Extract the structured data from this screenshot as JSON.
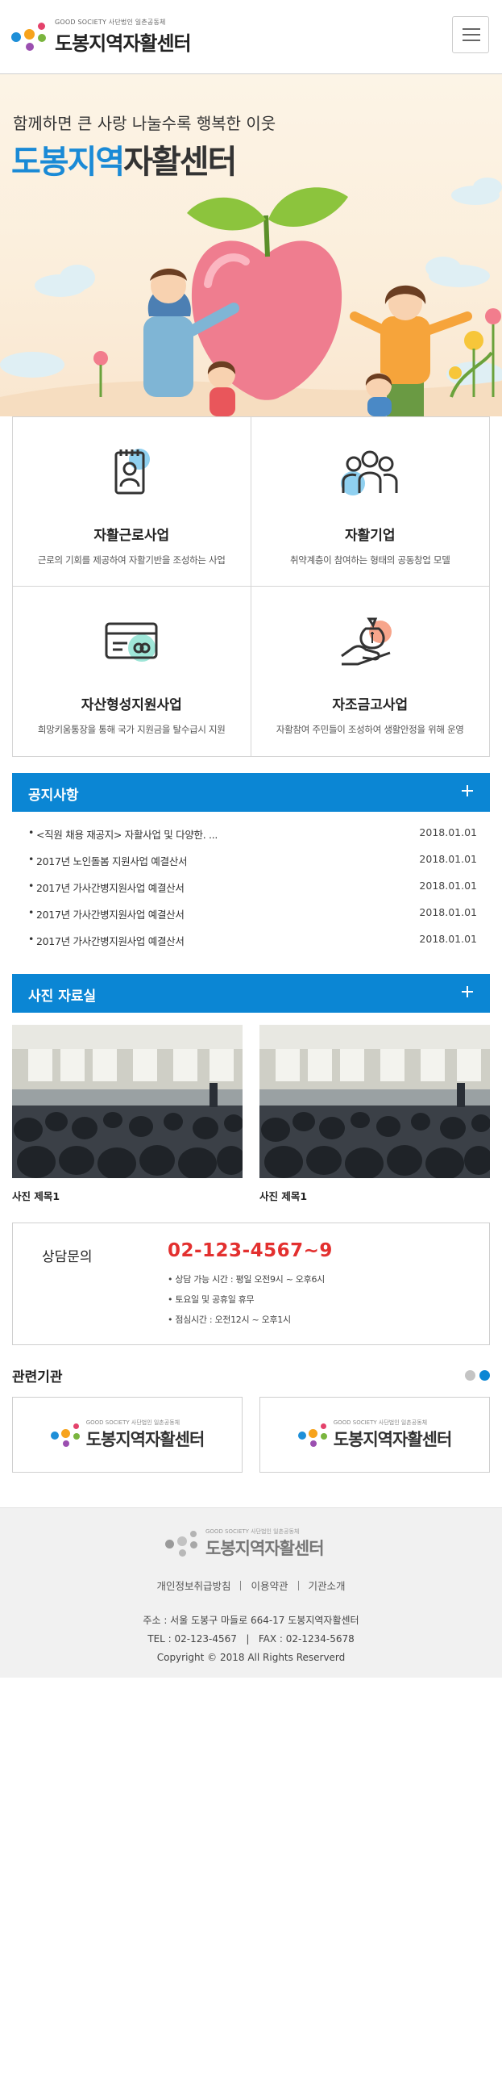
{
  "header": {
    "logo_sub": "GOOD SOCIETY 사단법인 일촌공동체",
    "logo_main": "도봉지역자활센터",
    "menu_icon": "hamburger-icon"
  },
  "hero": {
    "subtitle": "함께하면 큰 사랑 나눌수록 행복한 이웃",
    "title_blue": "도봉지역",
    "title_dark": "자활센터"
  },
  "business": [
    {
      "title": "자활근로사업",
      "desc": "근로의 기회를 제공하여 자활기반을 조성하는 사업",
      "icon": "id-badge-icon"
    },
    {
      "title": "자활기업",
      "desc": "취약계층이 참여하는 형태의 공동창업 모델",
      "icon": "people-group-icon"
    },
    {
      "title": "자산형성지원사업",
      "desc": "희망키움통장을 통해 국가 지원금을 탈수급시 지원",
      "icon": "card-icon"
    },
    {
      "title": "자조금고사업",
      "desc": "자활참여 주민들이 조성하여 생활안정을 위해 운영",
      "icon": "money-hand-icon"
    }
  ],
  "notice": {
    "title": "공지사항",
    "more_icon": "plus-icon",
    "items": [
      {
        "title": "<직원 채용 재공지> 자활사업 및 다양한. ...",
        "date": "2018.01.01"
      },
      {
        "title": "2017년 노인돌봄 지원사업 예결산서",
        "date": "2018.01.01"
      },
      {
        "title": "2017년 가사간병지원사업 예결산서",
        "date": "2018.01.01"
      },
      {
        "title": "2017년 가사간병지원사업 예결산서",
        "date": "2018.01.01"
      },
      {
        "title": "2017년 가사간병지원사업 예결산서",
        "date": "2018.01.01"
      }
    ]
  },
  "photos": {
    "title": "사진 자료실",
    "items": [
      {
        "caption": "사진 제목1"
      },
      {
        "caption": "사진 제목1"
      }
    ]
  },
  "consult": {
    "label": "상담문의",
    "phone": "02-123-4567~9",
    "notes": [
      "상담 가능 시간 : 평일 오전9시 ~ 오후6시",
      "토요일 및 공휴일 휴무",
      "점심시간 : 오전12시 ~ 오후1시"
    ]
  },
  "related": {
    "title": "관련기관",
    "items": [
      {
        "sub": "GOOD SOCIETY 사단법인 일촌공동체",
        "main": "도봉지역자활센터"
      },
      {
        "sub": "GOOD SOCIETY 사단법인 일촌공동체",
        "main": "도봉지역자활센터"
      }
    ]
  },
  "footer": {
    "logo_sub": "GOOD SOCIETY 사단법인 일촌공동체",
    "logo_main": "도봉지역자활센터",
    "links": [
      "개인정보취급방침",
      "이용약관",
      "기관소개"
    ],
    "address": "주소 : 서울 도봉구 마들로 664-17 도봉지역자활센터",
    "tel_fax": "TEL : 02-123-4567   |   FAX : 02-1234-5678",
    "copyright": "Copyright © 2018 All Rights Reserverd"
  },
  "colors": {
    "accent_blue": "#0b86d4",
    "phone_red": "#e3302f",
    "hero_bg": "#fcf4e6"
  }
}
